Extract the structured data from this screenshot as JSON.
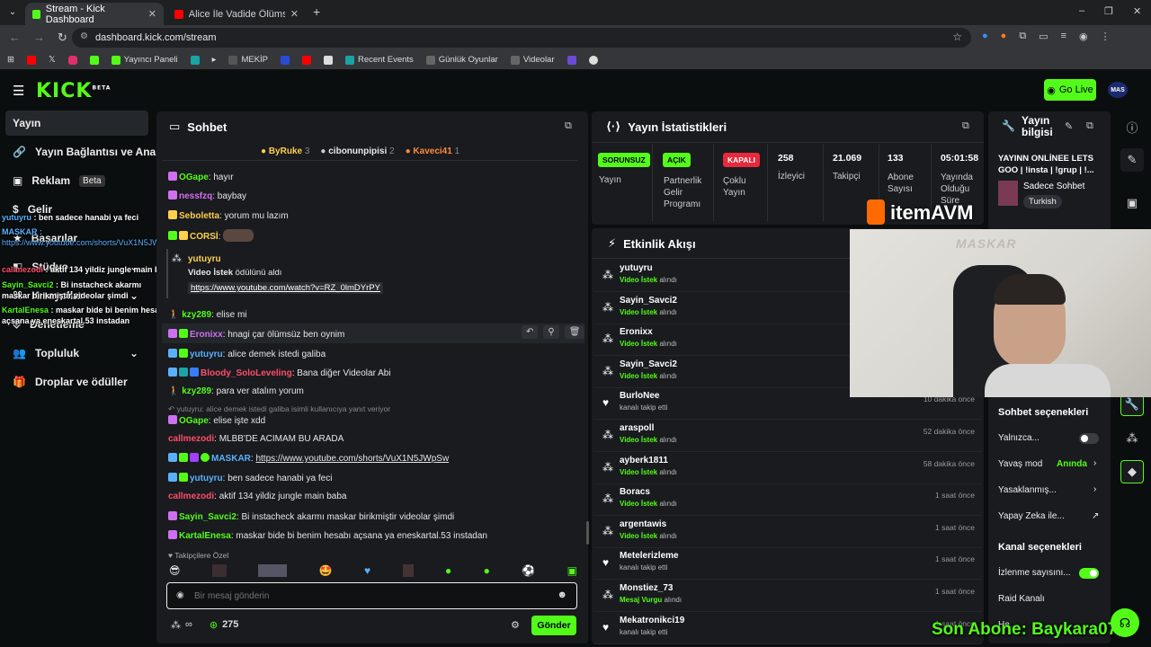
{
  "browser": {
    "tabs": [
      {
        "title": "Stream - Kick Dashboard",
        "active": true
      },
      {
        "title": "Alice İle Vadide Ölümsüz gibi O",
        "active": false
      }
    ],
    "url": "dashboard.kick.com/stream",
    "bookmarks": [
      "Yayıncı Paneli",
      "MEKİP",
      "Recent Events",
      "Günlük Oyunlar",
      "Videolar"
    ]
  },
  "header": {
    "logo": "KICK",
    "logo_sup": "BETA",
    "golive": "Go Live",
    "avatar": "MAS"
  },
  "sidebar": {
    "items": [
      {
        "label": "Yayın",
        "active": true
      },
      {
        "label": "Yayın Bağlantısı ve Anahtarı"
      },
      {
        "label": "Reklam",
        "badge": "Beta"
      },
      {
        "label": "Gelir"
      },
      {
        "label": "Başarılar"
      },
      {
        "label": "Stüdyo"
      },
      {
        "label": "Kısayollar"
      },
      {
        "label": "Denetleme"
      },
      {
        "label": "Topluluk"
      },
      {
        "label": "Droplar ve ödüller"
      }
    ]
  },
  "overlay_chat": [
    {
      "user": "yutuyru",
      "text": "ben sadece hanabi ya feci"
    },
    {
      "user": "MASKAR",
      "text": "https://www.youtube.com/shorts/VuX1N5JWpSw"
    },
    {
      "user": "callmezodi",
      "text": "aktif 134 yildiz jungle main baba"
    },
    {
      "user": "Sayin_Savci2",
      "text": "Bi instacheck akarmı maskar birikmiştir videolar şimdi"
    },
    {
      "user": "KartalEnesa",
      "text": "maskar bide bi benim hesabı açsana ya eneskartal.53 instadan"
    }
  ],
  "chat": {
    "title": "Sohbet",
    "top_gifters": [
      {
        "name": "ByRuke",
        "count": "3"
      },
      {
        "name": "cibonunpipisi",
        "count": "2"
      },
      {
        "name": "Kaveci41",
        "count": "1"
      }
    ],
    "messages": [
      {
        "user": "OGape",
        "text": "hayır",
        "color": "#53fc18"
      },
      {
        "user": "nessfzq",
        "text": "baybay",
        "color": "#d070f0"
      },
      {
        "user": "Seboletta",
        "text": "yorum mu lazım",
        "color": "#ffd04d"
      },
      {
        "user": "CORSİ",
        "text": "",
        "color": "#ffd04d"
      }
    ],
    "reward": {
      "user": "yutuyru",
      "title": "Video İstek",
      "suffix": "ödülünü aldı",
      "link": "https://www.youtube.com/watch?v=RZ_0lmDYrPY"
    },
    "messages2": [
      {
        "user": "kzy289",
        "text": "elise mi",
        "color": "#53fc18"
      },
      {
        "user": "Eronixx",
        "text": "hnagi çar ölümsüz ben oynim",
        "color": "#d070f0"
      },
      {
        "user": "yutuyru",
        "text": "alice demek istedi galiba",
        "color": "#53fc18"
      },
      {
        "user": "Bloody_SoloLeveling",
        "text": "Bana diğer Videolar Abi",
        "color": "#ff4d6a"
      },
      {
        "user": "kzy289",
        "text": "para ver atalım yorum",
        "color": "#53fc18"
      }
    ],
    "reply_ref": "yutuyru: alice demek istedi galiba isimli kullanıcıya yanıt veriyor",
    "messages3": [
      {
        "user": "OGape",
        "text": "elise işte xdd",
        "color": "#53fc18"
      },
      {
        "user": "callmezodi",
        "text": "MLBB'DE ACIMAM BU ARADA",
        "color": "#ff4d6a"
      },
      {
        "user": "MASKAR",
        "text": "https://www.youtube.com/shorts/VuX1N5JWpSw",
        "color": "#5ab0ff",
        "link": true
      },
      {
        "user": "yutuyru",
        "text": "ben sadece hanabi ya feci",
        "color": "#53fc18"
      },
      {
        "user": "callmezodi",
        "text": "aktif 134 yildiz jungle main baba",
        "color": "#ff4d6a"
      },
      {
        "user": "Sayin_Savci2",
        "text": "Bi instacheck akarmı maskar birikmiştir videolar şimdi",
        "color": "#53fc18"
      },
      {
        "user": "KartalEnesa",
        "text": "maskar bide bi benim hesabı açsana ya eneskartal.53 instadan",
        "color": "#53fc18"
      }
    ],
    "followers_only": "Takipçilere Özel",
    "input_placeholder": "Bir mesaj gönderin",
    "infinity": "∞",
    "points": "275",
    "send": "Gönder"
  },
  "stats": {
    "title": "Yayın İstatistikleri",
    "cells": [
      {
        "pill": "SORUNSUZ",
        "label": "Yayın",
        "pill_color": "#53fc18"
      },
      {
        "pill": "AÇIK",
        "label": "Partnerlik Gelir Programı",
        "pill_color": "#53fc18"
      },
      {
        "pill": "KAPALI",
        "label": "Çoklu Yayın",
        "pill_color": "#e8283c"
      },
      {
        "value": "258",
        "label": "İzleyici"
      },
      {
        "value": "21.069",
        "label": "Takipçi"
      },
      {
        "value": "133",
        "label": "Abone Sayısı"
      },
      {
        "value": "05:01:58",
        "label": "Yayında Olduğu Süre"
      }
    ]
  },
  "activity": {
    "title": "Etkinlik Akışı",
    "items": [
      {
        "name": "yutuyru",
        "hl": "Video İstek",
        "desc": "alındı",
        "time": "",
        "icon": "dots"
      },
      {
        "name": "Sayin_Savci2",
        "hl": "Video İstek",
        "desc": "alındı",
        "time": "",
        "icon": "dots"
      },
      {
        "name": "Eronixx",
        "hl": "Video İstek",
        "desc": "alındı",
        "time": "",
        "icon": "dots"
      },
      {
        "name": "Sayin_Savci2",
        "hl": "Video İstek",
        "desc": "alındı",
        "time": "",
        "icon": "dots"
      },
      {
        "name": "BurloNee",
        "hl": "",
        "desc": "kanalı takip etti",
        "time": "10 dakika önce",
        "icon": "heart"
      },
      {
        "name": "araspoll",
        "hl": "Video İstek",
        "desc": "alındı",
        "time": "52 dakika önce",
        "icon": "dots"
      },
      {
        "name": "ayberk1811",
        "hl": "Video İstek",
        "desc": "alındı",
        "time": "58 dakika önce",
        "icon": "dots"
      },
      {
        "name": "Boracs",
        "hl": "Video İstek",
        "desc": "alındı",
        "time": "1 saat önce",
        "icon": "dots"
      },
      {
        "name": "argentawis",
        "hl": "Video İstek",
        "desc": "alındı",
        "time": "1 saat önce",
        "icon": "dots"
      },
      {
        "name": "Metelerizleme",
        "hl": "",
        "desc": "kanalı takip etti",
        "time": "1 saat önce",
        "icon": "heart"
      },
      {
        "name": "Monstiez_73",
        "hl": "Mesaj Vurgu",
        "desc": "alındı",
        "time": "1 saat önce",
        "icon": "dots"
      },
      {
        "name": "Mekatronikci19",
        "hl": "",
        "desc": "kanalı takip etti",
        "time": "1 saat önce",
        "icon": "heart"
      }
    ]
  },
  "info": {
    "title": "Yayın bilgisi",
    "stream_title": "YAYINN ONLİNEE LETS GOO | !insta | !grup | !...",
    "category": "Sadece Sohbet",
    "language": "Turkish",
    "chat_options_title": "Sohbet seçenekleri",
    "chat_options": [
      {
        "label": "Yalnızca...",
        "type": "toggle",
        "on": false
      },
      {
        "label": "Yavaş mod",
        "value": "Anında",
        "type": "chevron"
      },
      {
        "label": "Yasaklanmış...",
        "type": "chevron"
      },
      {
        "label": "Yapay Zeka ile...",
        "type": "external"
      }
    ],
    "channel_options_title": "Kanal seçenekleri",
    "channel_options": [
      {
        "label": "İzlenme sayısını...",
        "type": "toggle",
        "on": true
      },
      {
        "label": "Raid Kanalı",
        "type": "none"
      },
      {
        "label": "He...",
        "type": "none"
      }
    ]
  },
  "overlay": {
    "brand": "itemAVM",
    "last_sub": "Son Abone: Baykara07",
    "webcam_caption": "MASKAR"
  }
}
